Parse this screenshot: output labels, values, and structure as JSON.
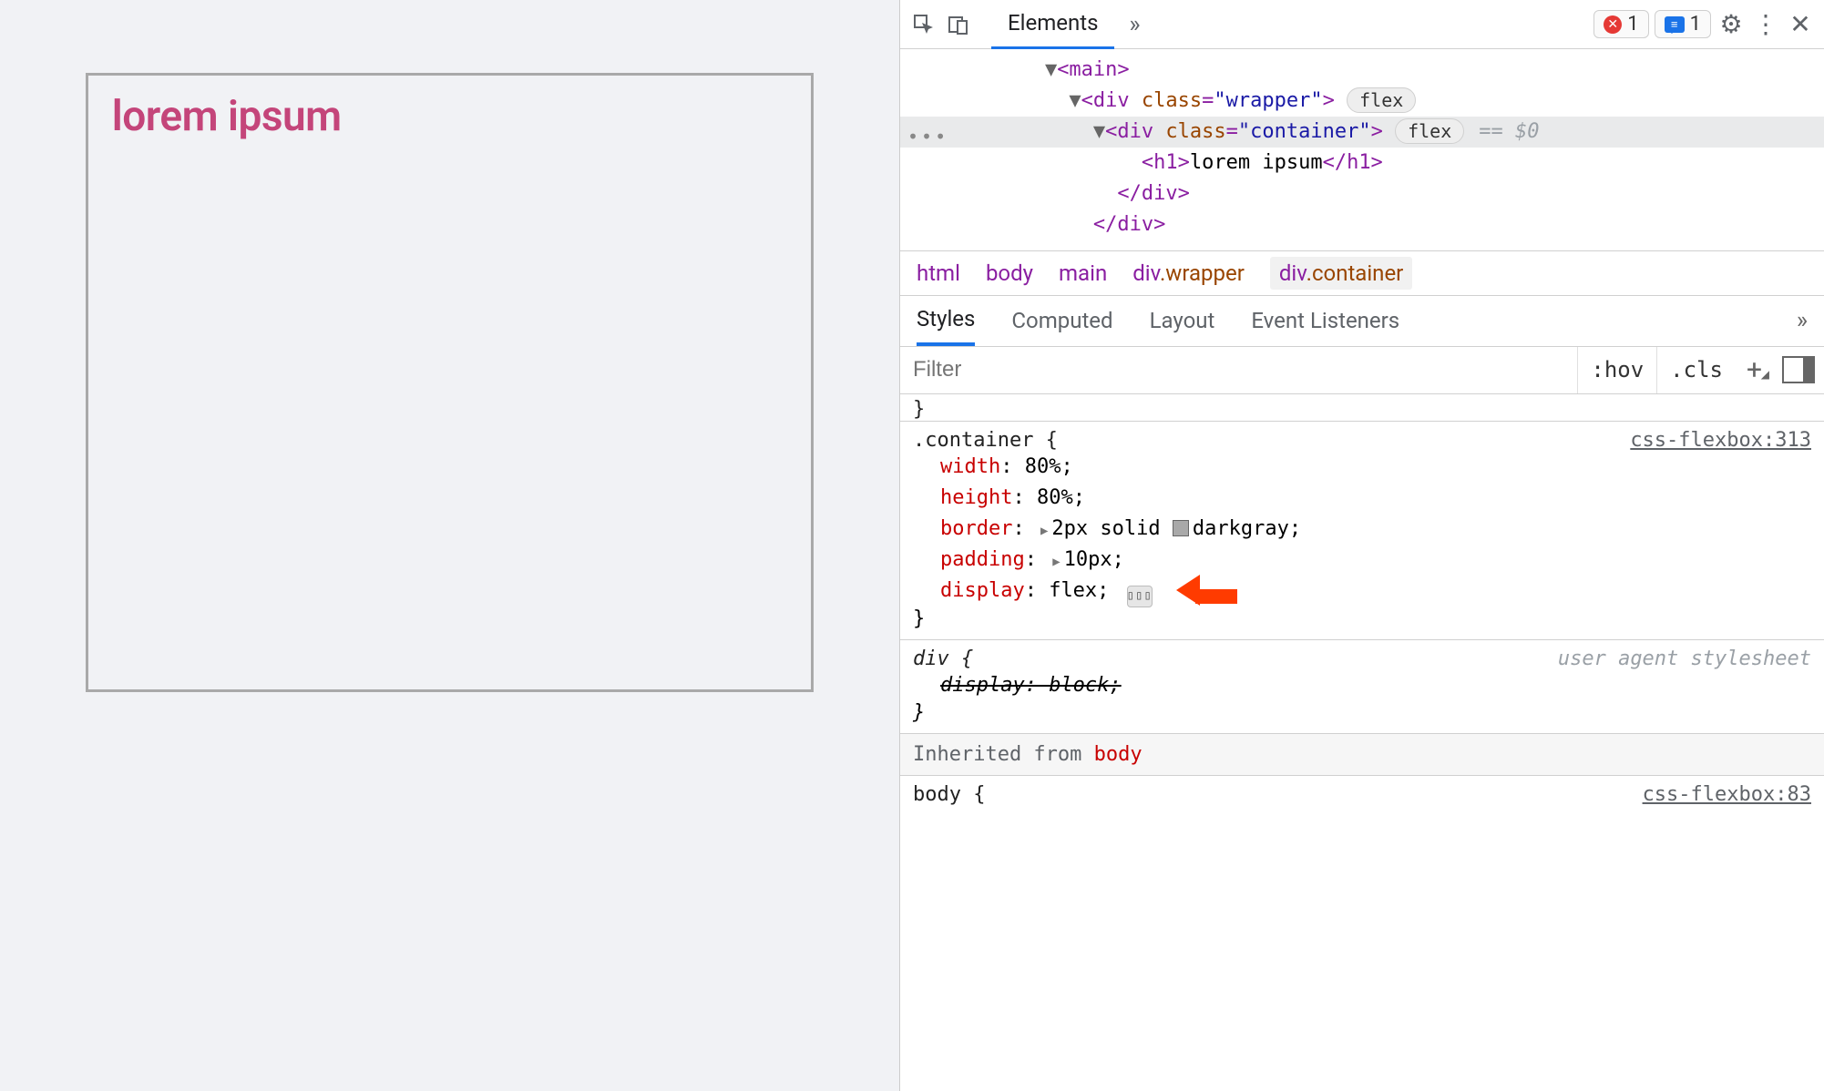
{
  "preview": {
    "heading": "lorem ipsum"
  },
  "toolbar": {
    "tabs": {
      "elements": "Elements"
    },
    "errors_count": "1",
    "messages_count": "1"
  },
  "dom": {
    "main_open": "<main>",
    "wrapper_open_1": "<div ",
    "wrapper_attr": "class",
    "wrapper_val": "\"wrapper\"",
    "wrapper_open_2": ">",
    "flex_badge": "flex",
    "container_open_1": "<div ",
    "container_attr": "class",
    "container_val": "\"container\"",
    "container_open_2": ">",
    "eq0": "== $0",
    "h1_open": "<h1>",
    "h1_text": "lorem ipsum",
    "h1_close": "</h1>",
    "container_close": "</div>",
    "wrapper_close": "</div>"
  },
  "crumb": {
    "c1": "html",
    "c2": "body",
    "c3": "main",
    "c4a": "div",
    "c4b": ".wrapper",
    "c5a": "div",
    "c5b": ".container"
  },
  "subtabs": {
    "styles": "Styles",
    "computed": "Computed",
    "layout": "Layout",
    "ev": "Event Listeners"
  },
  "filter": {
    "placeholder": "Filter",
    "hov": ":hov",
    "cls": ".cls"
  },
  "rules": {
    "container": {
      "selector": ".container {",
      "source": "css-flexbox:313",
      "width_p": "width",
      "width_v": ": 80%;",
      "height_p": "height",
      "height_v": ": 80%;",
      "border_p": "border",
      "border_v1": ": ",
      "border_v2": "2px solid ",
      "border_v3": "darkgray;",
      "padding_p": "padding",
      "padding_v": ": ",
      "padding_v2": "10px;",
      "display_p": "display",
      "display_v": ": flex;",
      "close": "}"
    },
    "div": {
      "selector": "div {",
      "ua": "user agent stylesheet",
      "decl": "display: block;",
      "close": "}"
    },
    "inherited_label": "Inherited from ",
    "inherited_from": "body",
    "body_sel": "body {",
    "body_src": "css-flexbox:83"
  }
}
